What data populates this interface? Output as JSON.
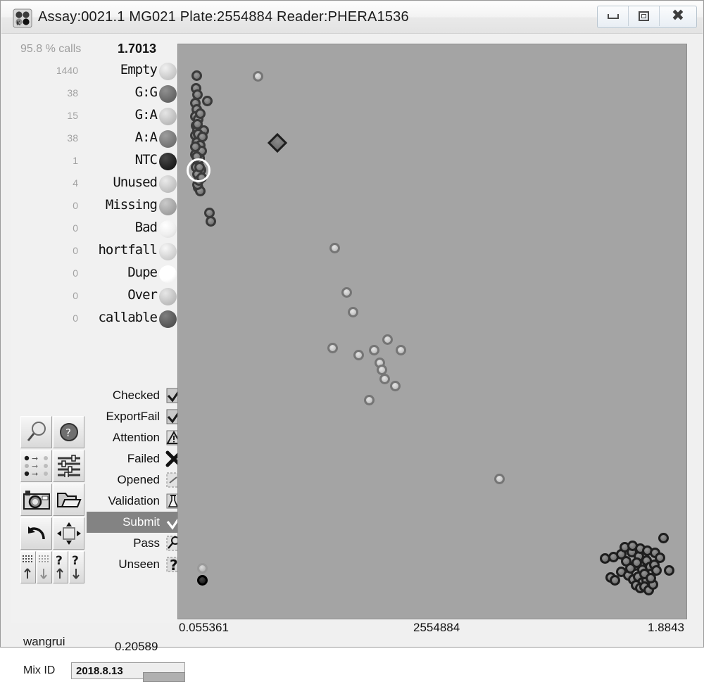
{
  "window": {
    "title": "Assay:0021.1 MG021  Plate:2554884  Reader:PHERA1536",
    "app_icon": "kbioscience-plate-icon",
    "controls": {
      "minimize": "minimize-button",
      "maximize": "maximize-button",
      "close": "close-button"
    }
  },
  "sidebar": {
    "percent_calls": "95.8 % calls",
    "upper_threshold": "1.7013",
    "lower_threshold": "0.20589",
    "user": "wangrui",
    "mix_id_label": "Mix ID",
    "mix_id_value": "2018.8.13",
    "legend": [
      {
        "count": "1440",
        "label": "Empty",
        "color": "#cfcfcf"
      },
      {
        "count": "38",
        "label": "G:G",
        "color": "#6e6e6e"
      },
      {
        "count": "15",
        "label": "G:A",
        "color": "#c3c3c3"
      },
      {
        "count": "38",
        "label": "A:A",
        "color": "#7c7c7c"
      },
      {
        "count": "1",
        "label": "NTC",
        "color": "#262626"
      },
      {
        "count": "4",
        "label": "Unused",
        "color": "#c8c8c8"
      },
      {
        "count": "0",
        "label": "Missing",
        "color": "#a8a8a8"
      },
      {
        "count": "0",
        "label": "Bad",
        "color": "#efefef"
      },
      {
        "count": "0",
        "label": "hortfall",
        "color": "#d6d6d6"
      },
      {
        "count": "0",
        "label": "Dupe",
        "color": "#ffffff"
      },
      {
        "count": "0",
        "label": "Over",
        "color": "#c5c5c5"
      },
      {
        "count": "0",
        "label": "callable",
        "color": "#5d5d5d"
      }
    ],
    "statuses": [
      {
        "label": "Checked",
        "icon": "checkmark-box-icon",
        "selected": false
      },
      {
        "label": "ExportFail",
        "icon": "checkmark-box-icon",
        "selected": false
      },
      {
        "label": "Attention",
        "icon": "warning-triangle-icon",
        "selected": false
      },
      {
        "label": "Failed",
        "icon": "cross-icon",
        "selected": false
      },
      {
        "label": "Opened",
        "icon": "dashed-box-icon",
        "selected": false
      },
      {
        "label": "Validation",
        "icon": "validation-flask-icon",
        "selected": false
      },
      {
        "label": "Submit",
        "icon": "checkmark-icon",
        "selected": true
      },
      {
        "label": "Pass",
        "icon": "magnifier-box-icon",
        "selected": false
      },
      {
        "label": "Unseen",
        "icon": "question-box-icon",
        "selected": false
      }
    ],
    "tools": [
      {
        "name": "zoom-magnifier-button",
        "icon": "magnifier-icon"
      },
      {
        "name": "help-button",
        "icon": "question-globe-icon"
      },
      {
        "name": "transform-points-button",
        "icon": "arrows-grid-icon"
      },
      {
        "name": "settings-sliders-button",
        "icon": "sliders-icon"
      },
      {
        "name": "snapshot-button",
        "icon": "camera-icon"
      },
      {
        "name": "open-folder-button",
        "icon": "folder-icon"
      },
      {
        "name": "undo-button",
        "icon": "undo-arrow-icon"
      },
      {
        "name": "fit-view-button",
        "icon": "resize-arrows-icon"
      },
      {
        "name": "grid-up-button",
        "icon": "grid-up-icon"
      },
      {
        "name": "grid-down-button",
        "icon": "grid-down-icon"
      },
      {
        "name": "unknown-up-button",
        "icon": "question-up-icon"
      },
      {
        "name": "unknown-down-button",
        "icon": "question-down-icon"
      }
    ]
  },
  "chart_data": {
    "type": "scatter",
    "title": "Assay:0021.1 MG021  Plate:2554884  Reader:PHERA1536",
    "xlabel": "",
    "ylabel": "",
    "grid": false,
    "legend_position": "left-sidebar",
    "axis_labels": {
      "x_left": "0.055361",
      "x_center": "2554884",
      "x_right": "1.8843",
      "y_top": "1.7013",
      "y_bottom": "0.20589"
    },
    "background_color": "#a4a4a4",
    "xlim": [
      0.055361,
      1.8843
    ],
    "ylim": [
      0.20589,
      1.7013
    ],
    "series": [
      {
        "name": "A:A",
        "color": "#7c7c7c",
        "edge": "#3a3a3a",
        "marker": "circle",
        "points": [
          [
            0.083,
            1.665
          ],
          [
            0.08,
            1.63
          ],
          [
            0.086,
            1.612
          ],
          [
            0.079,
            1.588
          ],
          [
            0.084,
            1.57
          ],
          [
            0.078,
            1.552
          ],
          [
            0.09,
            1.543
          ],
          [
            0.081,
            1.525
          ],
          [
            0.087,
            1.512
          ],
          [
            0.077,
            1.498
          ],
          [
            0.092,
            1.489
          ],
          [
            0.083,
            1.478
          ],
          [
            0.097,
            1.47
          ],
          [
            0.085,
            1.458
          ],
          [
            0.079,
            1.446
          ],
          [
            0.093,
            1.436
          ],
          [
            0.088,
            1.424
          ],
          [
            0.082,
            1.41
          ],
          [
            0.1,
            1.402
          ],
          [
            0.086,
            1.391
          ],
          [
            0.124,
            1.594
          ],
          [
            0.11,
            1.512
          ],
          [
            0.09,
            1.352
          ],
          [
            0.096,
            1.344
          ],
          [
            0.132,
            1.282
          ],
          [
            0.136,
            1.258
          ],
          [
            0.085,
            1.36
          ],
          [
            0.091,
            1.372
          ],
          [
            0.103,
            1.455
          ],
          [
            0.079,
            1.467
          ],
          [
            0.095,
            1.433
          ],
          [
            0.089,
            1.503
          ],
          [
            0.101,
            1.38
          ],
          [
            0.094,
            1.41
          ],
          [
            0.083,
            1.44
          ],
          [
            0.105,
            1.495
          ],
          [
            0.087,
            1.53
          ],
          [
            0.098,
            1.56
          ]
        ]
      },
      {
        "name": "G:G",
        "color": "#787878",
        "edge": "#1e1e1e",
        "marker": "circle",
        "points": [
          [
            1.64,
            0.318
          ],
          [
            1.672,
            0.322
          ],
          [
            1.7,
            0.33
          ],
          [
            1.72,
            0.31
          ],
          [
            1.74,
            0.336
          ],
          [
            1.755,
            0.3
          ],
          [
            1.768,
            0.324
          ],
          [
            1.782,
            0.288
          ],
          [
            1.796,
            0.312
          ],
          [
            1.81,
            0.296
          ],
          [
            1.7,
            0.282
          ],
          [
            1.728,
            0.272
          ],
          [
            1.746,
            0.26
          ],
          [
            1.764,
            0.268
          ],
          [
            1.78,
            0.252
          ],
          [
            1.798,
            0.258
          ],
          [
            1.812,
            0.276
          ],
          [
            1.826,
            0.302
          ],
          [
            1.836,
            0.286
          ],
          [
            1.756,
            0.244
          ],
          [
            1.772,
            0.236
          ],
          [
            1.79,
            0.24
          ],
          [
            1.806,
            0.23
          ],
          [
            1.822,
            0.246
          ],
          [
            1.66,
            0.266
          ],
          [
            1.676,
            0.258
          ],
          [
            1.714,
            0.35
          ],
          [
            1.744,
            0.354
          ],
          [
            1.774,
            0.346
          ],
          [
            1.8,
            0.34
          ],
          [
            1.828,
            0.334
          ],
          [
            1.848,
            0.32
          ],
          [
            1.736,
            0.292
          ],
          [
            1.76,
            0.306
          ],
          [
            1.788,
            0.276
          ],
          [
            1.814,
            0.264
          ],
          [
            1.862,
            0.376
          ],
          [
            1.884,
            0.286
          ]
        ]
      },
      {
        "name": "G:A",
        "color": "#c7c7c7",
        "edge": "#757575",
        "marker": "circle",
        "points": [
          [
            0.61,
            1.185
          ],
          [
            0.655,
            1.06
          ],
          [
            0.68,
            1.005
          ],
          [
            0.6,
            0.905
          ],
          [
            0.7,
            0.885
          ],
          [
            0.76,
            0.9
          ],
          [
            0.78,
            0.865
          ],
          [
            0.79,
            0.845
          ],
          [
            0.81,
            0.93
          ],
          [
            0.8,
            0.82
          ],
          [
            0.84,
            0.8
          ],
          [
            0.86,
            0.9
          ],
          [
            0.74,
            0.76
          ],
          [
            1.238,
            0.54
          ],
          [
            0.318,
            1.664
          ]
        ]
      },
      {
        "name": "NTC",
        "color": "#262626",
        "edge": "#000000",
        "marker": "circle",
        "points": [
          [
            0.106,
            0.258
          ]
        ]
      },
      {
        "name": "Unused",
        "color": "#bdbdbd",
        "edge": "#9a9a9a",
        "marker": "circle",
        "points": [
          [
            0.106,
            0.292
          ]
        ]
      },
      {
        "name": "Selected-Diamond",
        "color": "#6b6b6b",
        "edge": "#1e1e1e",
        "marker": "diamond",
        "points": [
          [
            0.39,
            1.478
          ]
        ]
      }
    ],
    "highlighted_point": {
      "x": 0.09,
      "y": 1.402,
      "ring_color": "#ffffff"
    }
  }
}
